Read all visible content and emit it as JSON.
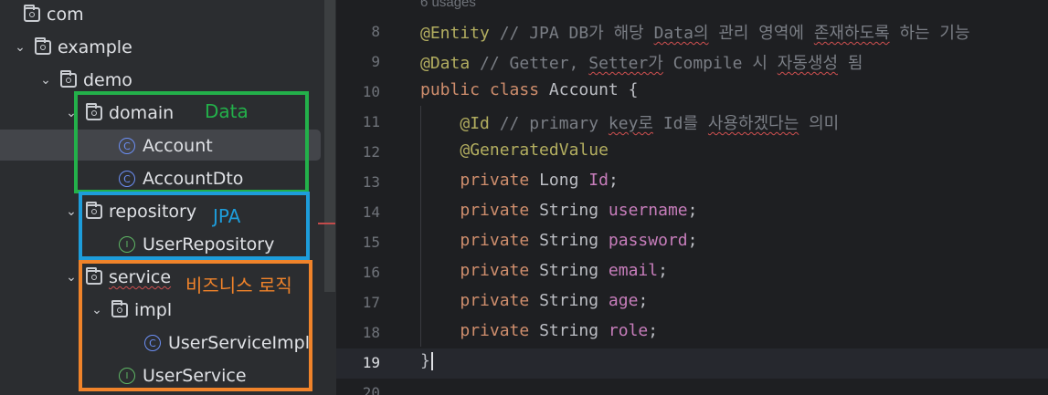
{
  "project_tree": {
    "items": [
      {
        "label": "com",
        "kind": "folder",
        "chevron": "none"
      },
      {
        "label": "example",
        "kind": "folder",
        "chevron": "expanded"
      },
      {
        "label": "demo",
        "kind": "folder",
        "chevron": "expanded"
      },
      {
        "label": "domain",
        "kind": "folder",
        "chevron": "expanded"
      },
      {
        "label": "Account",
        "kind": "class",
        "selected": true
      },
      {
        "label": "AccountDto",
        "kind": "class"
      },
      {
        "label": "repository",
        "kind": "folder",
        "chevron": "expanded"
      },
      {
        "label": "UserRepository",
        "kind": "interface"
      },
      {
        "label": "service",
        "kind": "folder",
        "chevron": "expanded",
        "misspelled": true
      },
      {
        "label": "impl",
        "kind": "folder",
        "chevron": "expanded"
      },
      {
        "label": "UserServiceImpl",
        "kind": "class"
      },
      {
        "label": "UserService",
        "kind": "interface"
      }
    ],
    "icons": {
      "folder": "folder-icon",
      "class": "class-icon",
      "interface": "interface-icon",
      "expanded": "chevron-down-icon"
    }
  },
  "annotations": {
    "data": "Data",
    "jpa": "JPA",
    "service": "비즈니스 로직",
    "colors": {
      "data": "#23b04a",
      "jpa": "#1d9ddb",
      "service": "#f0832a"
    }
  },
  "editor": {
    "usages": "6 usages",
    "current_line": 19,
    "lines": [
      {
        "number": "8",
        "tokens": [
          [
            "ann",
            "@Entity"
          ],
          [
            "cm",
            " // JPA DB가 해당 "
          ],
          [
            "cmw",
            "Data의"
          ],
          [
            "cm",
            " 관리 영역에 "
          ],
          [
            "cmw",
            "존재하도록"
          ],
          [
            "cm",
            " 하는 기능"
          ]
        ]
      },
      {
        "number": "9",
        "tokens": [
          [
            "ann",
            "@Data"
          ],
          [
            "cm",
            " // Getter, "
          ],
          [
            "cmw",
            "Setter가"
          ],
          [
            "cm",
            " Compile 시 "
          ],
          [
            "cmw",
            "자동생성"
          ],
          [
            "cm",
            " 됨"
          ]
        ]
      },
      {
        "number": "10",
        "tokens": [
          [
            "kw",
            "public class "
          ],
          [
            "txt",
            "Account {"
          ]
        ]
      },
      {
        "number": "11",
        "tokens": [
          [
            "txt",
            "    "
          ],
          [
            "ann",
            "@Id"
          ],
          [
            "cm",
            " // primary "
          ],
          [
            "cmw",
            "key로"
          ],
          [
            "cm",
            " Id를 "
          ],
          [
            "cmw",
            "사용하겠다는"
          ],
          [
            "cm",
            " 의미"
          ]
        ]
      },
      {
        "number": "12",
        "tokens": [
          [
            "txt",
            "    "
          ],
          [
            "ann",
            "@GeneratedValue"
          ]
        ]
      },
      {
        "number": "13",
        "tokens": [
          [
            "txt",
            "    "
          ],
          [
            "kw",
            "private "
          ],
          [
            "txt",
            "Long "
          ],
          [
            "fld",
            "Id"
          ],
          [
            "txt",
            ";"
          ]
        ]
      },
      {
        "number": "14",
        "tokens": [
          [
            "txt",
            "    "
          ],
          [
            "kw",
            "private "
          ],
          [
            "txt",
            "String "
          ],
          [
            "fld",
            "username"
          ],
          [
            "txt",
            ";"
          ]
        ]
      },
      {
        "number": "15",
        "tokens": [
          [
            "txt",
            "    "
          ],
          [
            "kw",
            "private "
          ],
          [
            "txt",
            "String "
          ],
          [
            "fld",
            "password"
          ],
          [
            "txt",
            ";"
          ]
        ]
      },
      {
        "number": "16",
        "tokens": [
          [
            "txt",
            "    "
          ],
          [
            "kw",
            "private "
          ],
          [
            "txt",
            "String "
          ],
          [
            "fld",
            "email"
          ],
          [
            "txt",
            ";"
          ]
        ]
      },
      {
        "number": "17",
        "tokens": [
          [
            "txt",
            "    "
          ],
          [
            "kw",
            "private "
          ],
          [
            "txt",
            "String "
          ],
          [
            "fld",
            "age"
          ],
          [
            "txt",
            ";"
          ]
        ]
      },
      {
        "number": "18",
        "tokens": [
          [
            "txt",
            "    "
          ],
          [
            "kw",
            "private "
          ],
          [
            "txt",
            "String "
          ],
          [
            "fld",
            "role"
          ],
          [
            "txt",
            ";"
          ]
        ]
      },
      {
        "number": "19",
        "tokens": [
          [
            "txt",
            "}"
          ]
        ]
      },
      {
        "number": "20",
        "tokens": []
      }
    ],
    "colors": {
      "annotation": "#b3ae60",
      "comment": "#7a7e85",
      "keyword": "#cf8e6d",
      "field": "#c77dbb",
      "text": "#bcbec4"
    }
  }
}
